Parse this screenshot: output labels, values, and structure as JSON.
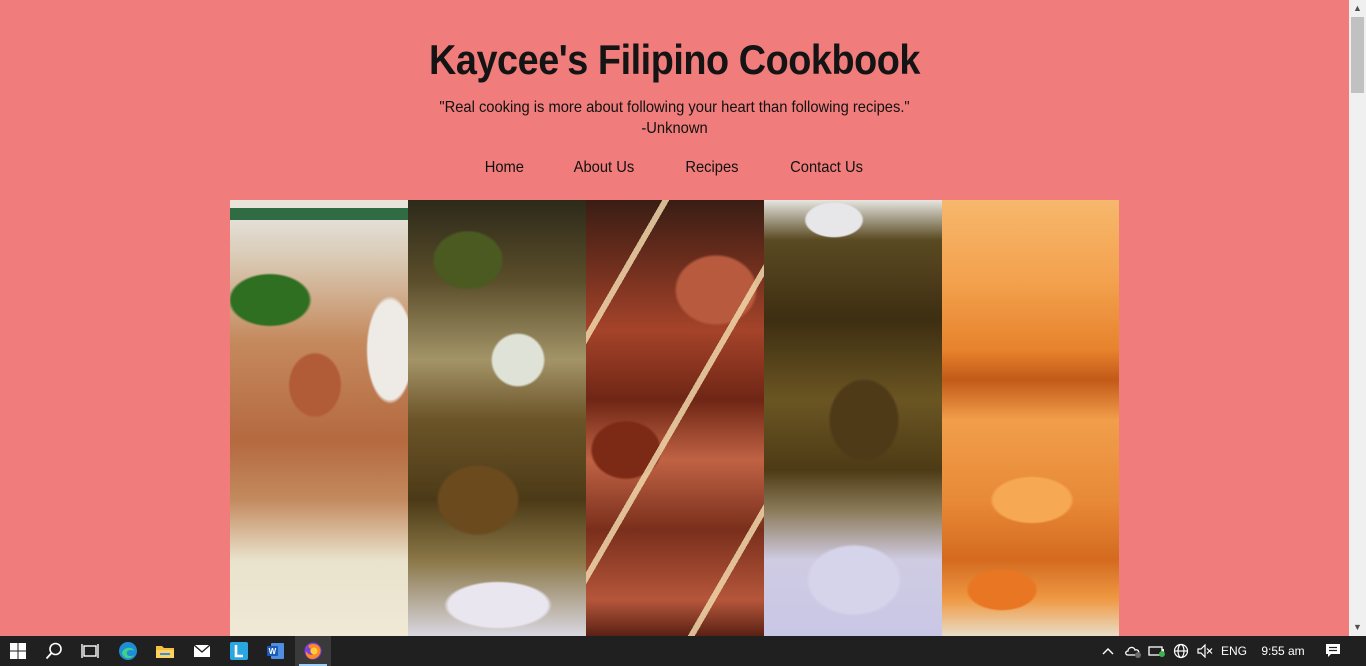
{
  "header": {
    "title": "Kaycee's Filipino Cookbook",
    "quote": "\"Real cooking is more about following your heart than following recipes.\"",
    "quote_author": "-Unknown"
  },
  "nav": {
    "items": [
      "Home",
      "About Us",
      "Recipes",
      "Contact Us"
    ]
  },
  "gallery": {
    "images": [
      "sinigang-photo",
      "adobo-photo",
      "barbecue-skewers-photo",
      "adobo-rice-photo",
      "lumpia-photo"
    ]
  },
  "taskbar": {
    "apps": [
      "start-icon",
      "search-icon",
      "task-view-icon",
      "edge-icon",
      "file-explorer-icon",
      "mail-icon",
      "l-app-icon",
      "word-icon",
      "firefox-icon"
    ],
    "active_app": "firefox-icon",
    "language": "ENG",
    "time": "9:55 am"
  },
  "colors": {
    "background": "#f07c7b",
    "taskbar": "#202020"
  }
}
